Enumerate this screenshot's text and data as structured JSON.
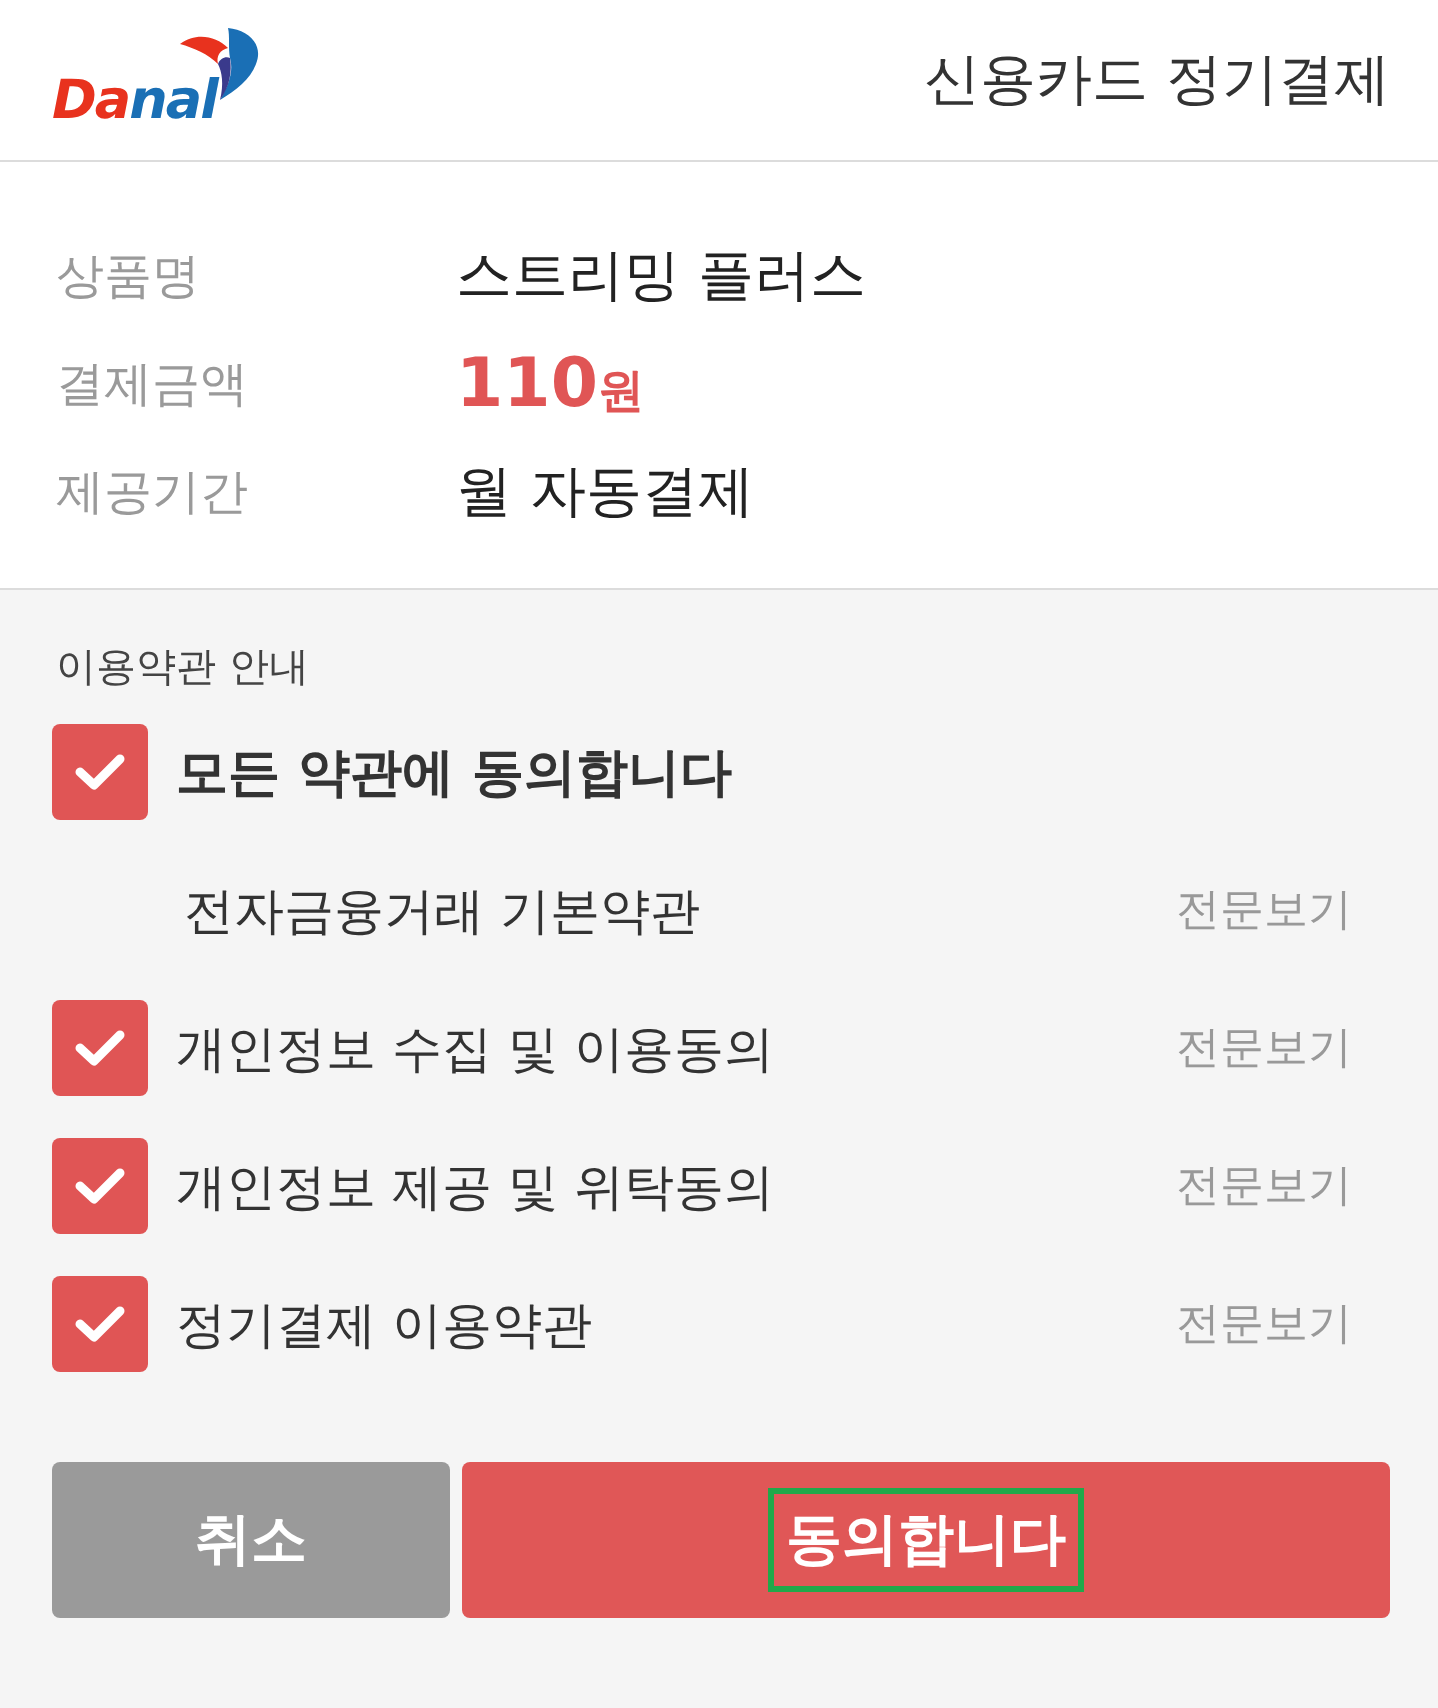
{
  "header": {
    "logo": [
      {
        "text": "Da",
        "color": "#e8321e"
      },
      {
        "text": "nal",
        "color": "#1a6fb5"
      }
    ],
    "title": "신용카드 정기결제"
  },
  "product": [
    {
      "kind": "text",
      "label": "상품명",
      "value": "스트리밍 플러스"
    },
    {
      "kind": "price",
      "label": "결제금액",
      "amount": "110",
      "unit": "원"
    },
    {
      "kind": "text",
      "label": "제공기간",
      "value": "월 자동결제"
    }
  ],
  "terms": {
    "heading": "이용약관 안내",
    "agree_all": {
      "label": "모든 약관에 동의합니다",
      "checked": true
    },
    "items": [
      {
        "kind": "plain",
        "label": "전자금융거래 기본약관",
        "link": "전문보기"
      },
      {
        "kind": "checkbox",
        "label": "개인정보 수집 및 이용동의",
        "checked": true,
        "link": "전문보기"
      },
      {
        "kind": "checkbox",
        "label": "개인정보 제공 및 위탁동의",
        "checked": true,
        "link": "전문보기"
      },
      {
        "kind": "checkbox",
        "label": "정기결제 이용약관",
        "checked": true,
        "link": "전문보기"
      }
    ]
  },
  "buttons": [
    {
      "kind": "cancel",
      "label": "취소",
      "highlighted": false
    },
    {
      "kind": "confirm",
      "label": "동의합니다",
      "highlighted": true
    }
  ]
}
